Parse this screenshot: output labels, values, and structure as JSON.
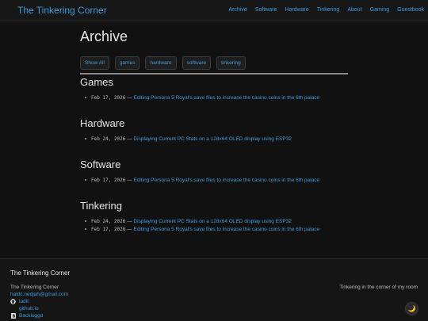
{
  "header": {
    "site_title": "The Tinkering Corner",
    "nav": [
      "Archive",
      "Software",
      "Hardware",
      "Tinkering",
      "About",
      "Gaming",
      "Guestbook"
    ]
  },
  "main": {
    "title": "Archive",
    "tags": [
      "Show All",
      "games",
      "hardware",
      "software",
      "tinkering"
    ],
    "sections": [
      {
        "heading": "Games",
        "posts": [
          {
            "date": "Feb 17, 2026",
            "title": "Editing Persona 5 Royal's save files to increase the casino coins in the 6th palace"
          }
        ]
      },
      {
        "heading": "Hardware",
        "posts": [
          {
            "date": "Feb 24, 2026",
            "title": "Displaying Current PC Stats on a 128x64 OLED display using ESP32"
          }
        ]
      },
      {
        "heading": "Software",
        "posts": [
          {
            "date": "Feb 17, 2026",
            "title": "Editing Persona 5 Royal's save files to increase the casino coins in the 6th palace"
          }
        ]
      },
      {
        "heading": "Tinkering",
        "posts": [
          {
            "date": "Feb 24, 2026",
            "title": "Displaying Current PC Stats on a 128x64 OLED display using ESP32"
          },
          {
            "date": "Feb 17, 2026",
            "title": "Editing Persona 5 Royal's save files to increase the casino coins in the 6th palace"
          }
        ]
      }
    ],
    "separator": "—"
  },
  "footer": {
    "title": "The Tinkering Corner",
    "name": "The Tinkering Corner",
    "email": "haldc.nedjah@gmail.com",
    "links": [
      {
        "label": "ladit",
        "icon": "github-icon"
      },
      {
        "label": "github.io",
        "icon": "none"
      },
      {
        "label": "Backloggd",
        "icon": "backloggd-icon"
      }
    ],
    "tagline": "Tinkering in the corner of my room",
    "theme_toggle_icon": "🌙"
  },
  "colors": {
    "background": "#111111",
    "accent": "#3d9be0",
    "text": "#d6d6d6"
  }
}
